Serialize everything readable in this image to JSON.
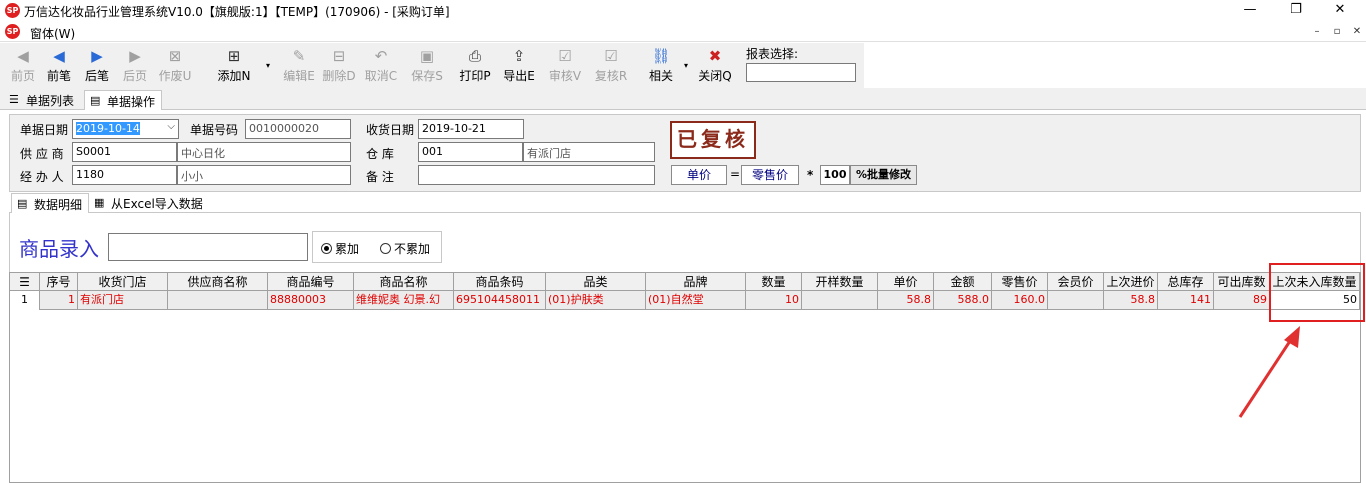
{
  "window": {
    "title": "万信达化妆品行业管理系统V10.0【旗舰版:1】【TEMP】(170906) - [采购订单]",
    "logo_text": "SP",
    "minimize": "—",
    "restore": "❐",
    "close": "✕"
  },
  "menu": {
    "window_label": "窗体(W)",
    "mdi_min": "–",
    "mdi_restore": "▫",
    "mdi_close": "✕"
  },
  "toolbar": {
    "buttons": [
      {
        "label": "前页",
        "icon": "◀",
        "enabled": false
      },
      {
        "label": "前笔",
        "icon": "◀",
        "enabled": true
      },
      {
        "label": "后笔",
        "icon": "▶",
        "enabled": true
      },
      {
        "label": "后页",
        "icon": "▶",
        "enabled": false
      },
      {
        "label": "作废U",
        "icon": "⊠",
        "enabled": false
      },
      {
        "label": "添加N",
        "icon": "⊞",
        "enabled": true
      },
      {
        "label": "编辑E",
        "icon": "✎",
        "enabled": false
      },
      {
        "label": "删除D",
        "icon": "⊟",
        "enabled": false
      },
      {
        "label": "取消C",
        "icon": "↶",
        "enabled": false
      },
      {
        "label": "保存S",
        "icon": "▣",
        "enabled": false
      },
      {
        "label": "打印P",
        "icon": "⎙",
        "enabled": true
      },
      {
        "label": "导出E",
        "icon": "⇪",
        "enabled": true
      },
      {
        "label": "审核V",
        "icon": "☑",
        "enabled": false
      },
      {
        "label": "复核R",
        "icon": "☑",
        "enabled": false
      },
      {
        "label": "相关",
        "icon": "⛓",
        "enabled": true
      },
      {
        "label": "关闭Q",
        "icon": "✖",
        "enabled": true
      }
    ],
    "report_label": "报表选择:",
    "report_value": ""
  },
  "doc_tabs": [
    "单据列表",
    "单据操作"
  ],
  "form": {
    "doc_date_label": "单据日期",
    "doc_date": "2019-10-14",
    "doc_no_label": "单据号码",
    "doc_no": "0010000020",
    "recv_date_label": "收货日期",
    "recv_date": "2019-10-21",
    "supplier_label": "供 应 商",
    "supplier_code": "S0001",
    "supplier_name": "中心日化",
    "warehouse_label": "仓    库",
    "warehouse_code": "001",
    "warehouse_name": "有派门店",
    "handler_label": "经 办 人",
    "handler_code": "1180",
    "handler_name": "小小",
    "remark_label": "备    注",
    "remark": "",
    "status_stamp": "已复核",
    "price_label": "单价",
    "eq": "=",
    "retail_label": "零售价",
    "times": "*",
    "pct": "100",
    "batch_btn": "%批量修改"
  },
  "sub_tabs": [
    "数据明细",
    "从Excel导入数据"
  ],
  "entry": {
    "label": "商品录入",
    "value": "",
    "radio_add": "累加",
    "radio_noadd": "不累加"
  },
  "grid": {
    "columns": [
      "序号",
      "收货门店",
      "供应商名称",
      "商品编号",
      "商品名称",
      "商品条码",
      "品类",
      "品牌",
      "数量",
      "开样数量",
      "单价",
      "金额",
      "零售价",
      "会员价",
      "上次进价",
      "总库存",
      "可出库数",
      "上次未入库数量"
    ],
    "rows": [
      {
        "rownum": "1",
        "cells": [
          "1",
          "有派门店",
          "",
          "88880003",
          "维维妮奥 幻景.幻",
          "695104458011",
          "(01)护肤类",
          "(01)自然堂",
          "10",
          "",
          "58.8",
          "588.0",
          "160.0",
          "",
          "58.8",
          "141",
          "89",
          "50"
        ]
      }
    ]
  },
  "colors": {
    "accent_red": "#e02020",
    "stamp": "#8b2a1a",
    "entry_label": "#3333cc"
  }
}
